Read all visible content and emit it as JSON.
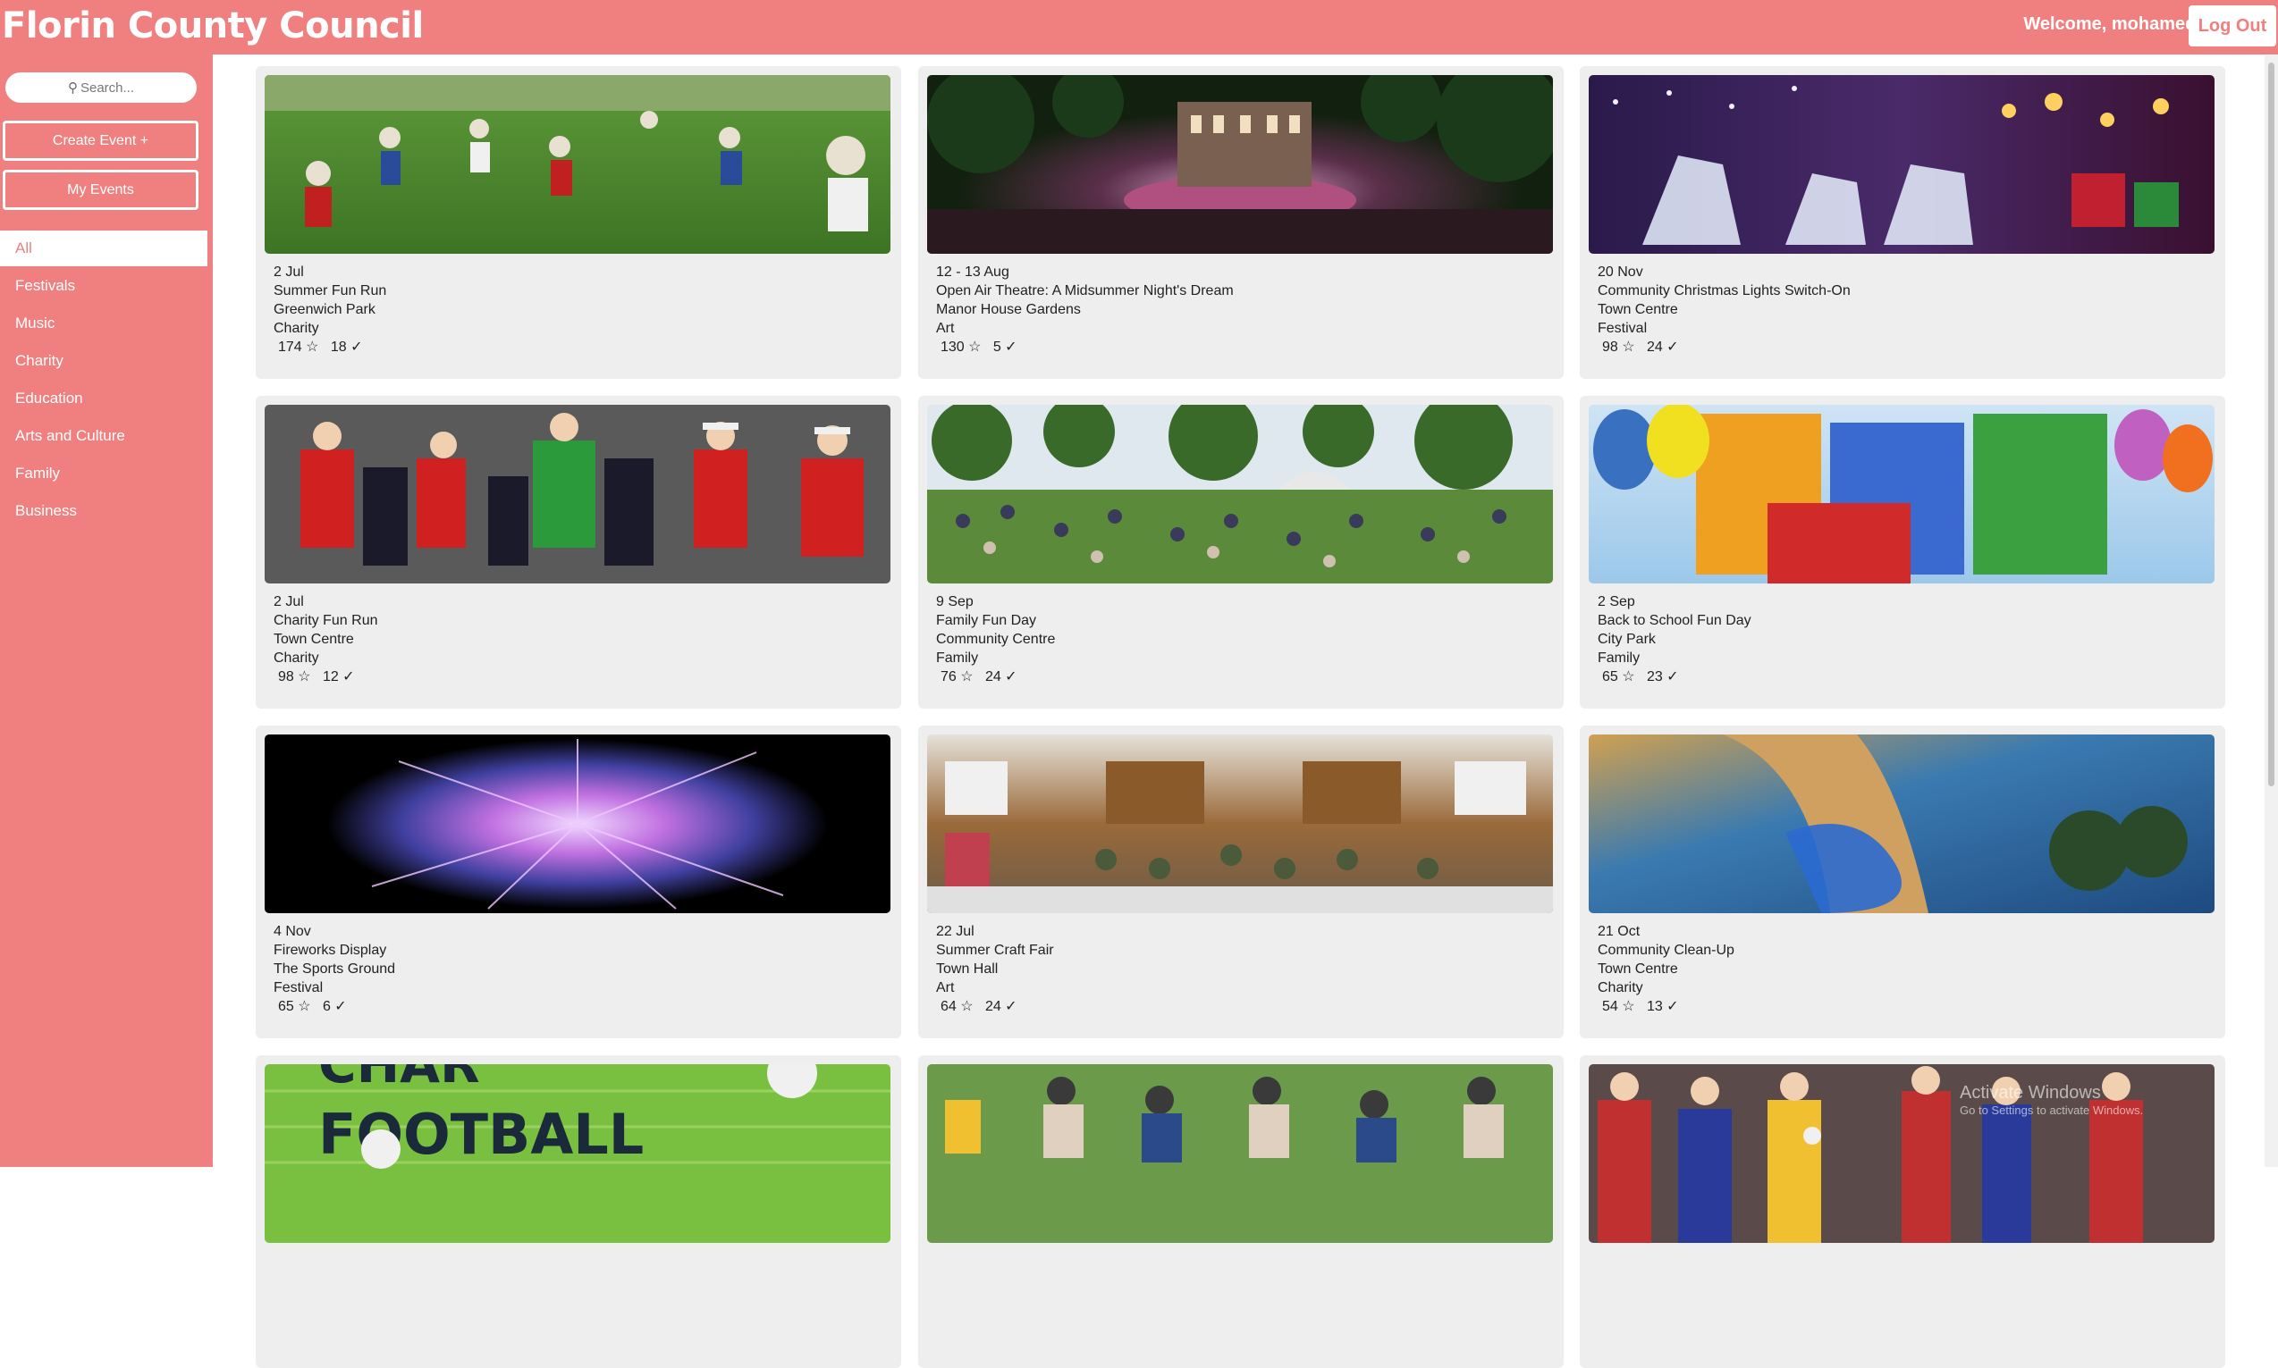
{
  "header": {
    "title": "Florin County Council",
    "welcome": "Welcome, mohamed!",
    "logout_label": "Log Out"
  },
  "sidebar": {
    "search_placeholder": "Search...",
    "create_label": "Create Event +",
    "my_events_label": "My Events",
    "categories": [
      "All",
      "Festivals",
      "Music",
      "Charity",
      "Education",
      "Arts and Culture",
      "Family",
      "Business"
    ],
    "active_category": "All"
  },
  "events": [
    {
      "date": "2 Jul",
      "title": "Summer Fun Run",
      "location": "Greenwich Park",
      "category": "Charity",
      "interested": "174 ☆",
      "going": "18 ✓",
      "image": "children-running-park"
    },
    {
      "date": "12 - 13 Aug",
      "title": "Open Air Theatre: A Midsummer Night's Dream",
      "location": "Manor House Gardens",
      "category": "Art",
      "interested": "130 ☆",
      "going": "5 ✓",
      "image": "night-stage-audience"
    },
    {
      "date": "20 Nov",
      "title": "Community Christmas Lights Switch-On",
      "location": "Town Centre",
      "category": "Festival",
      "interested": "98 ☆",
      "going": "24 ✓",
      "image": "christmas-light-reindeer"
    },
    {
      "date": "2 Jul",
      "title": "Charity Fun Run",
      "location": "Town Centre",
      "category": "Charity",
      "interested": "98 ☆",
      "going": "12 ✓",
      "image": "santa-runners"
    },
    {
      "date": "9 Sep",
      "title": "Family Fun Day",
      "location": "Community Centre",
      "category": "Family",
      "interested": "76 ☆",
      "going": "24 ✓",
      "image": "crowd-park-stage"
    },
    {
      "date": "2 Sep",
      "title": "Back to School Fun Day",
      "location": "City Park",
      "category": "Family",
      "interested": "65 ☆",
      "going": "23 ✓",
      "image": "fun-day-balloons"
    },
    {
      "date": "4 Nov",
      "title": "Fireworks Display",
      "location": "The Sports Ground",
      "category": "Festival",
      "interested": "65 ☆",
      "going": "6 ✓",
      "image": "fireworks-night"
    },
    {
      "date": "22 Jul",
      "title": "Summer Craft Fair",
      "location": "Town Hall",
      "category": "Art",
      "interested": "64 ☆",
      "going": "24 ✓",
      "image": "indoor-craft-hall"
    },
    {
      "date": "21 Oct",
      "title": "Community Clean-Up",
      "location": "Town Centre",
      "category": "Charity",
      "interested": "54 ☆",
      "going": "13 ✓",
      "image": "litter-picking"
    },
    {
      "image": "charity-football-poster",
      "poster_text": "FOOTBALL"
    },
    {
      "image": "seated-crowd-grass"
    },
    {
      "image": "costumed-crowd"
    }
  ],
  "watermark": {
    "line1": "Activate Windows",
    "line2": "Go to Settings to activate Windows."
  },
  "colors": {
    "brand": "#f07f7f",
    "card": "#eeeeee",
    "text": "#222222"
  }
}
